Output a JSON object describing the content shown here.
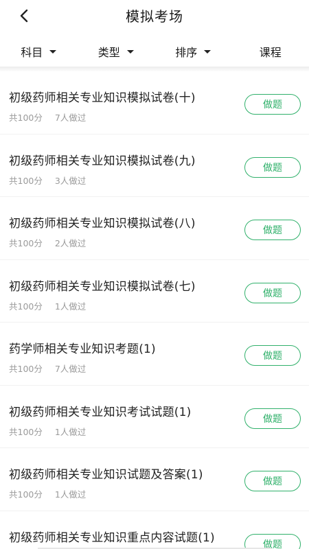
{
  "header": {
    "title": "模拟考场"
  },
  "filters": [
    {
      "label": "科目",
      "has_caret": true
    },
    {
      "label": "类型",
      "has_caret": true
    },
    {
      "label": "排序",
      "has_caret": true
    },
    {
      "label": "课程",
      "has_caret": false
    }
  ],
  "icons": {
    "back": "chevron-left-icon",
    "caret": "caret-down-icon"
  },
  "colors": {
    "accent": "#2fb06a",
    "meta_text": "#9a9a9a"
  },
  "list": {
    "button_label": "做题",
    "items": [
      {
        "title": "初级药师相关专业知识模拟试卷(十)",
        "score": "共100分",
        "count": "7人做过"
      },
      {
        "title": "初级药师相关专业知识模拟试卷(九)",
        "score": "共100分",
        "count": "3人做过"
      },
      {
        "title": "初级药师相关专业知识模拟试卷(八)",
        "score": "共100分",
        "count": "2人做过"
      },
      {
        "title": "初级药师相关专业知识模拟试卷(七)",
        "score": "共100分",
        "count": "1人做过"
      },
      {
        "title": "药学师相关专业知识考题(1)",
        "score": "共100分",
        "count": "7人做过"
      },
      {
        "title": "初级药师相关专业知识考试试题(1)",
        "score": "共100分",
        "count": "1人做过"
      },
      {
        "title": "初级药师相关专业知识试题及答案(1)",
        "score": "共100分",
        "count": "1人做过"
      },
      {
        "title": "初级药师相关专业知识重点内容试题(1)",
        "score": "",
        "count": ""
      }
    ]
  }
}
